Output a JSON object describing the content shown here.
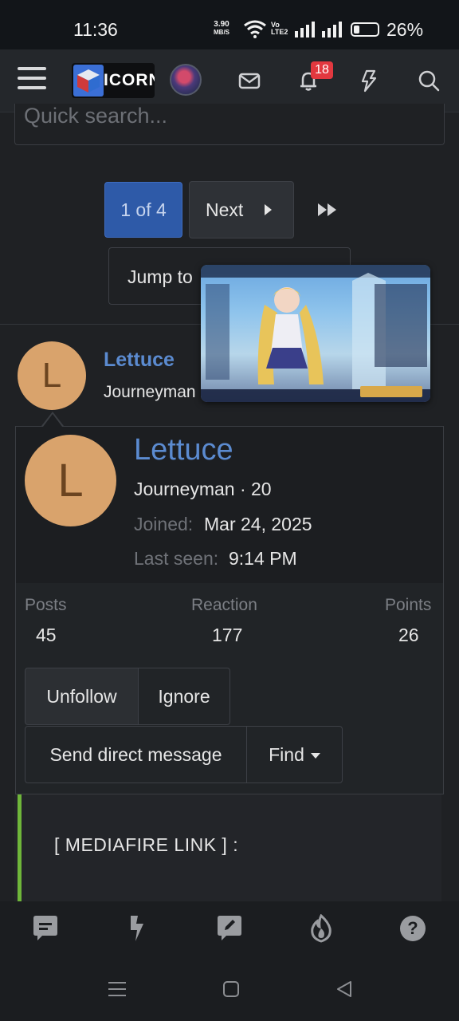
{
  "status_bar": {
    "time": "11:36",
    "net_speed_value": "3.90",
    "net_speed_unit": "MB/S",
    "volte_top": "Vo",
    "volte_bottom": "LTE2",
    "battery_percent": "26%",
    "battery_level": 0.26
  },
  "header": {
    "logo_text": "ICORN",
    "notification_count": "18",
    "icons": [
      "menu-icon",
      "inbox-icon",
      "bell-icon",
      "lightning-icon",
      "search-icon"
    ]
  },
  "search": {
    "placeholder": "Quick search..."
  },
  "pagination": {
    "current": "1 of 4",
    "next_label": "Next",
    "jump_label": "Jump to"
  },
  "post": {
    "avatar_letter": "L",
    "author": "Lettuce",
    "user_title": "Journeyman"
  },
  "profile_popup": {
    "avatar_letter": "L",
    "name": "Lettuce",
    "title_line": "Journeyman · 20",
    "joined_label": "Joined:",
    "joined_value": "Mar 24, 2025",
    "last_seen_label": "Last seen:",
    "last_seen_value": "9:14 PM",
    "stats": [
      {
        "label": "Posts",
        "value": "45"
      },
      {
        "label": "Reaction",
        "value": "177"
      },
      {
        "label": "Points",
        "value": "26"
      }
    ],
    "buttons": {
      "unfollow": "Unfollow",
      "ignore": "Ignore",
      "message": "Send direct message",
      "find": "Find"
    }
  },
  "content": {
    "link_text": "[ MEDIAFIRE LINK ] :"
  },
  "bottom_nav": {
    "icons": [
      "chat-icon",
      "whats-new-icon",
      "compose-icon",
      "trending-icon",
      "help-icon"
    ]
  },
  "system_nav": {
    "icons": [
      "recents-icon",
      "home-icon",
      "back-icon"
    ]
  }
}
